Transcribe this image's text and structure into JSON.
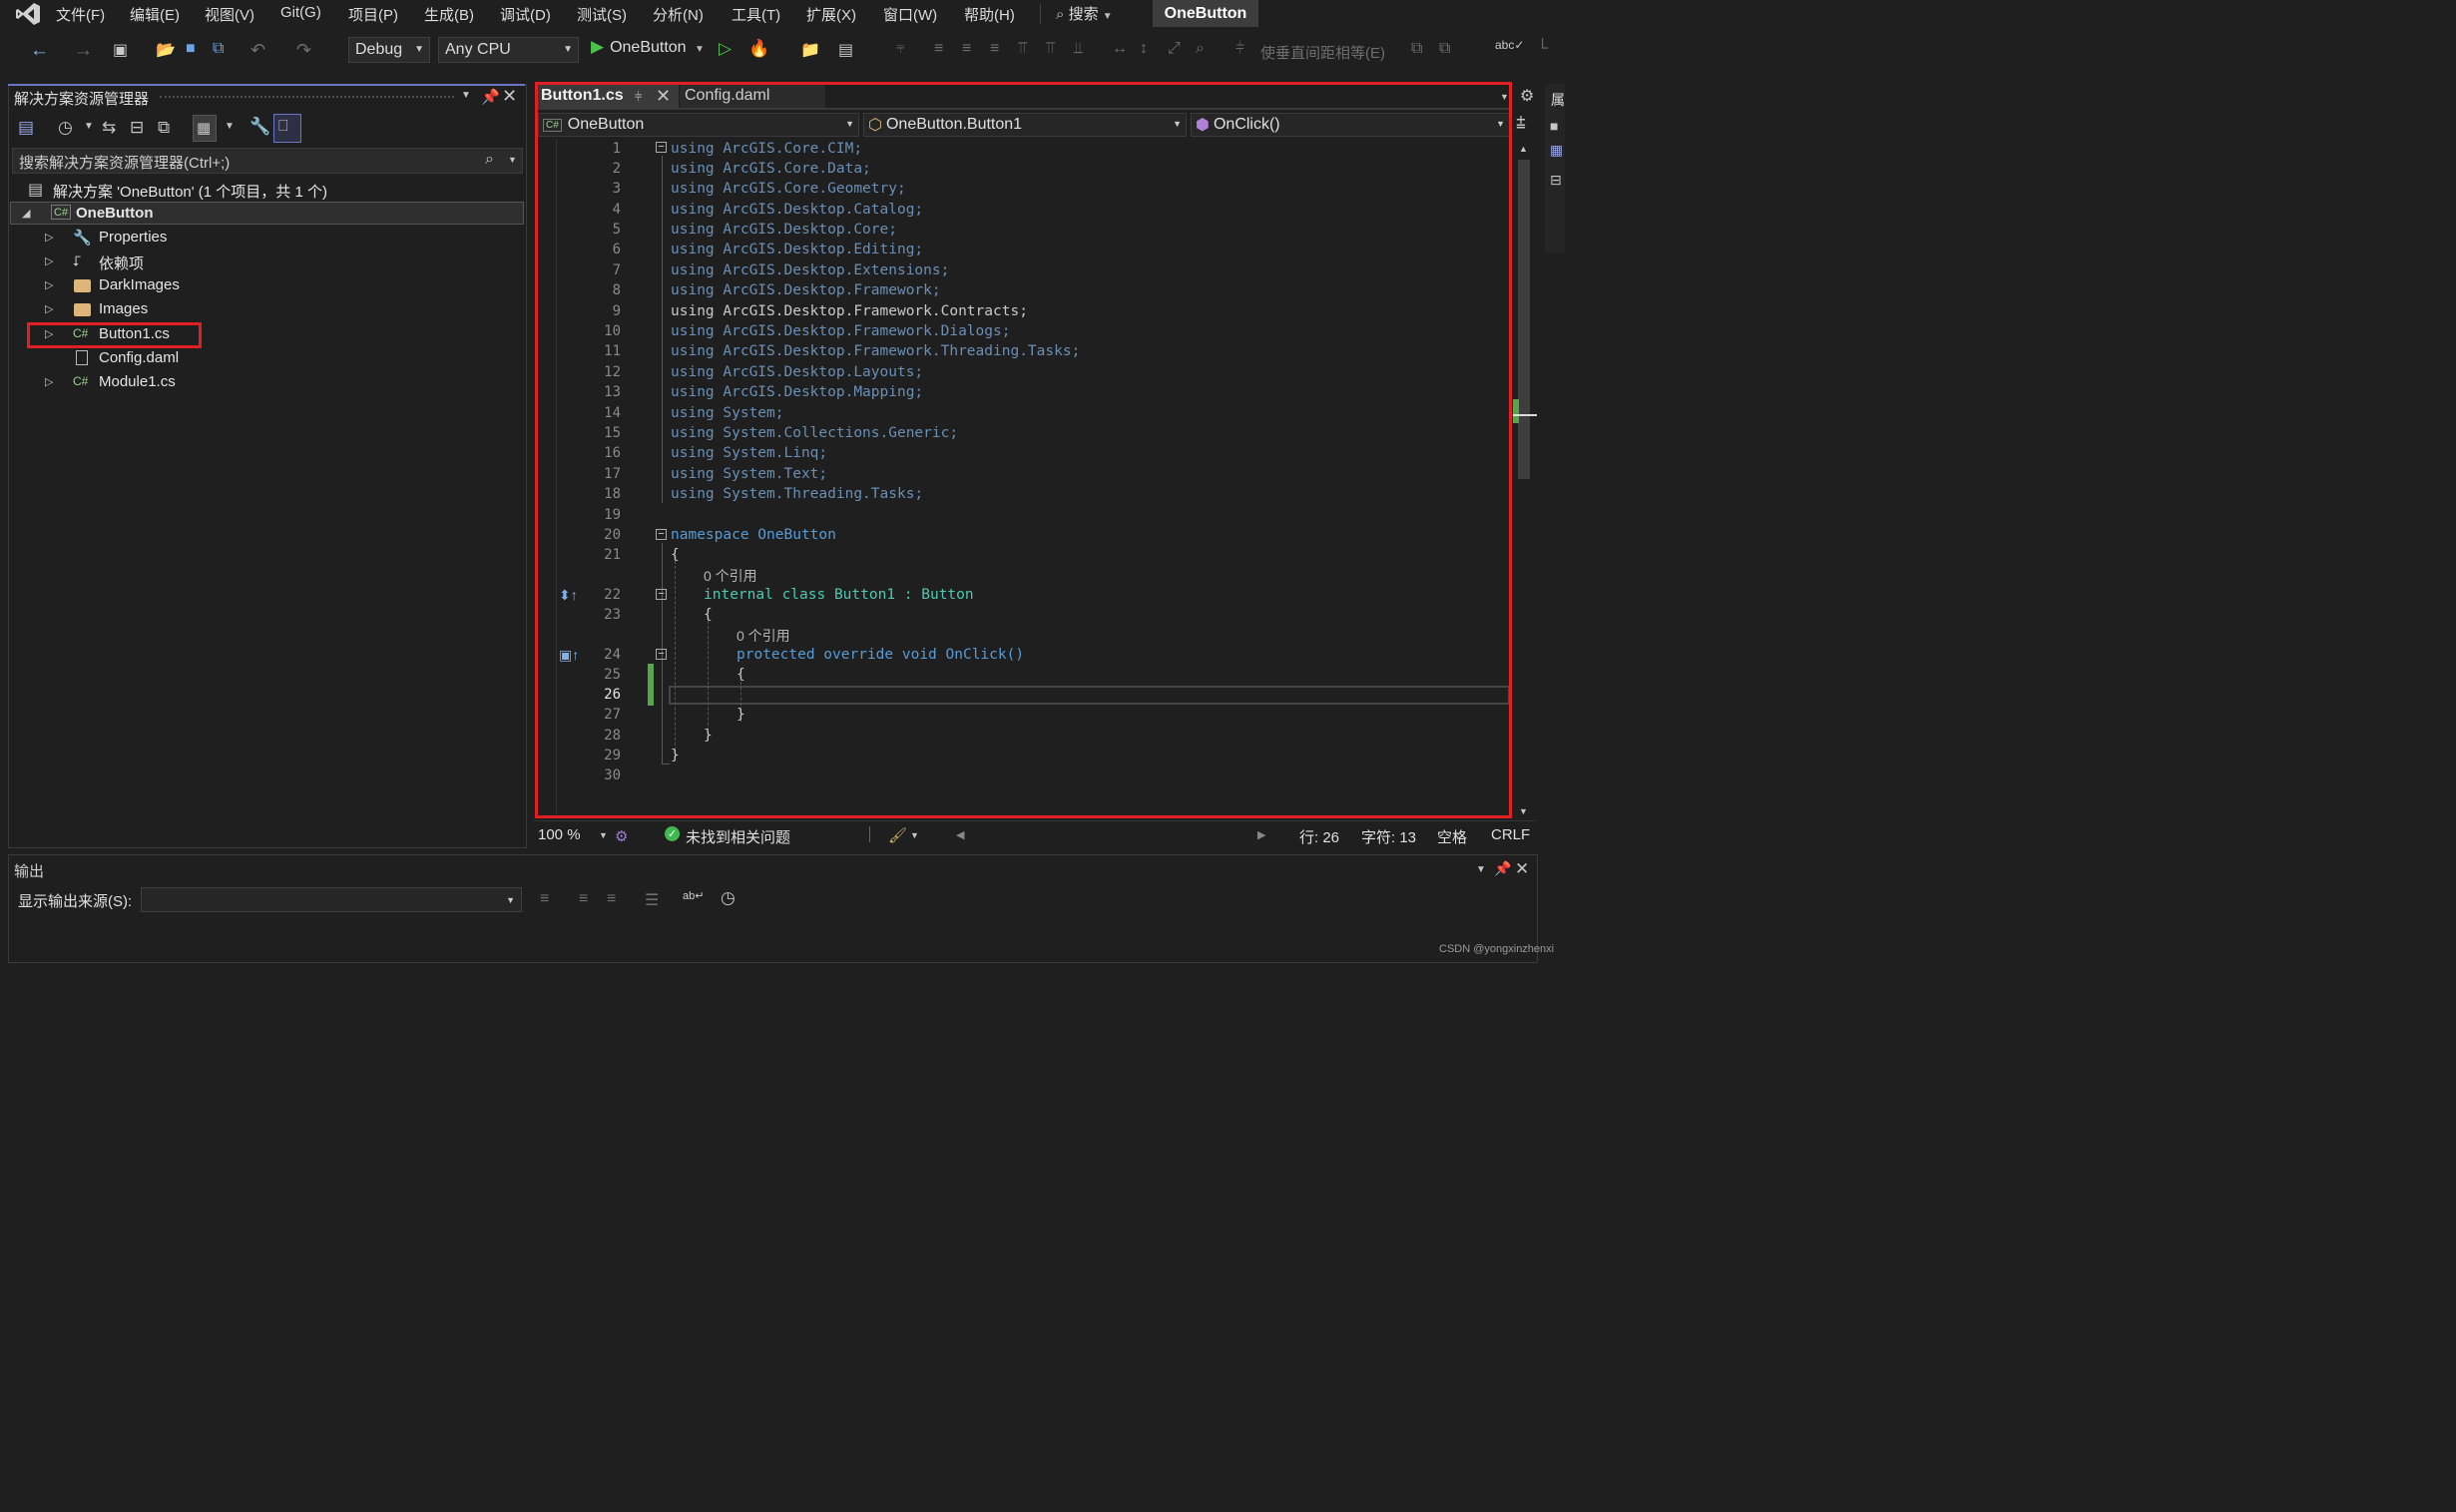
{
  "menu": {
    "items": [
      "文件(F)",
      "编辑(E)",
      "视图(V)",
      "Git(G)",
      "项目(P)",
      "生成(B)",
      "调试(D)",
      "测试(S)",
      "分析(N)",
      "工具(T)",
      "扩展(X)",
      "窗口(W)",
      "帮助(H)"
    ],
    "search": "搜索",
    "solution_title": "OneButton"
  },
  "toolbar": {
    "config": "Debug",
    "platform": "Any CPU",
    "run_label": "OneButton",
    "spacing_label": "使垂直间距相等(E)"
  },
  "solution_explorer": {
    "title": "解决方案资源管理器",
    "search_placeholder": "搜索解决方案资源管理器(Ctrl+;)",
    "solution_label": "解决方案 'OneButton' (1 个项目，共 1 个)",
    "project": "OneButton",
    "items": [
      "Properties",
      "依赖项",
      "DarkImages",
      "Images",
      "Button1.cs",
      "Config.daml",
      "Module1.cs"
    ]
  },
  "editor": {
    "tabs": [
      "Button1.cs",
      "Config.daml"
    ],
    "nav": [
      "OneButton",
      "OneButton.Button1",
      "OnClick()"
    ],
    "lines": [
      {
        "n": "1",
        "t": "using ArcGIS.Core.CIM;"
      },
      {
        "n": "2",
        "t": "using ArcGIS.Core.Data;"
      },
      {
        "n": "3",
        "t": "using ArcGIS.Core.Geometry;"
      },
      {
        "n": "4",
        "t": "using ArcGIS.Desktop.Catalog;"
      },
      {
        "n": "5",
        "t": "using ArcGIS.Desktop.Core;"
      },
      {
        "n": "6",
        "t": "using ArcGIS.Desktop.Editing;"
      },
      {
        "n": "7",
        "t": "using ArcGIS.Desktop.Extensions;"
      },
      {
        "n": "8",
        "t": "using ArcGIS.Desktop.Framework;"
      },
      {
        "n": "9",
        "t": "using ArcGIS.Desktop.Framework.Contracts;"
      },
      {
        "n": "10",
        "t": "using ArcGIS.Desktop.Framework.Dialogs;"
      },
      {
        "n": "11",
        "t": "using ArcGIS.Desktop.Framework.Threading.Tasks;"
      },
      {
        "n": "12",
        "t": "using ArcGIS.Desktop.Layouts;"
      },
      {
        "n": "13",
        "t": "using ArcGIS.Desktop.Mapping;"
      },
      {
        "n": "14",
        "t": "using System;"
      },
      {
        "n": "15",
        "t": "using System.Collections.Generic;"
      },
      {
        "n": "16",
        "t": "using System.Linq;"
      },
      {
        "n": "17",
        "t": "using System.Text;"
      },
      {
        "n": "18",
        "t": "using System.Threading.Tasks;"
      },
      {
        "n": "19",
        "t": ""
      },
      {
        "n": "20",
        "t": "namespace OneButton"
      },
      {
        "n": "21",
        "t": "{"
      },
      {
        "n": "22",
        "t": "internal class Button1 : Button"
      },
      {
        "n": "23",
        "t": "{"
      },
      {
        "n": "24",
        "t": "protected override void OnClick()"
      },
      {
        "n": "25",
        "t": "{"
      },
      {
        "n": "26",
        "t": ""
      },
      {
        "n": "27",
        "t": "}"
      },
      {
        "n": "28",
        "t": "}"
      },
      {
        "n": "29",
        "t": "}"
      },
      {
        "n": "30",
        "t": ""
      }
    ],
    "ref_label": "0 个引用"
  },
  "status": {
    "zoom": "100 %",
    "issues": "未找到相关问题",
    "line": "行: 26",
    "char": "字符: 13",
    "space": "空格",
    "eol": "CRLF"
  },
  "output": {
    "title": "输出",
    "source_label": "显示输出来源(S):"
  },
  "right_panel": {
    "title": "属"
  },
  "watermark": "CSDN @yongxinzhenxi",
  "colors": {
    "keyword": "#569cd6",
    "type": "#4ec9b0",
    "method": "#dcdcaa",
    "highlight": "#e02020",
    "accent": "#4bc24b"
  }
}
